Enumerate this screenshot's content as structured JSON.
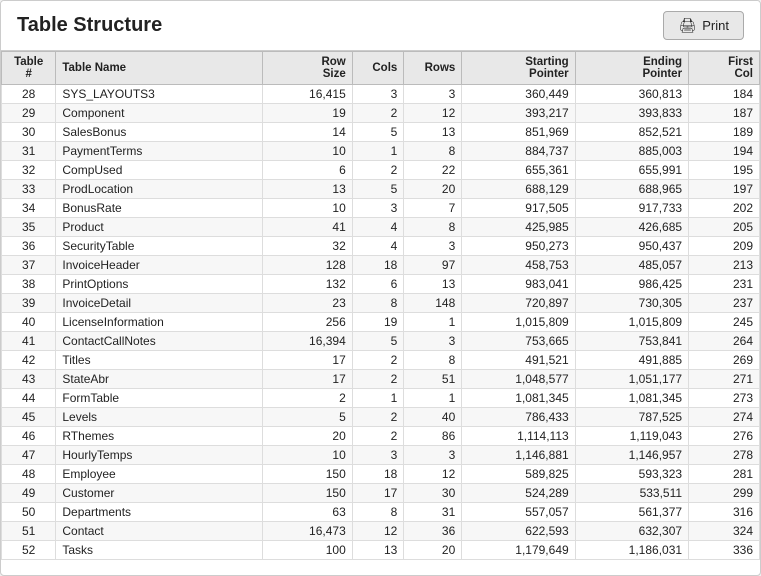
{
  "header": {
    "title": "Table Structure",
    "print_button": "Print"
  },
  "table": {
    "columns": [
      {
        "key": "table_num",
        "label": "Table\n#"
      },
      {
        "key": "table_name",
        "label": "Table Name"
      },
      {
        "key": "row_size",
        "label": "Row\nSize"
      },
      {
        "key": "cols",
        "label": "Cols"
      },
      {
        "key": "rows",
        "label": "Rows"
      },
      {
        "key": "starting_pointer",
        "label": "Starting\nPointer"
      },
      {
        "key": "ending_pointer",
        "label": "Ending\nPointer"
      },
      {
        "key": "first_col",
        "label": "First\nCol"
      }
    ],
    "rows": [
      {
        "table_num": "28",
        "table_name": "SYS_LAYOUTS3",
        "row_size": "16,415",
        "cols": "3",
        "rows": "3",
        "starting_pointer": "360,449",
        "ending_pointer": "360,813",
        "first_col": "184",
        "highlight": ""
      },
      {
        "table_num": "29",
        "table_name": "Component",
        "row_size": "19",
        "cols": "2",
        "rows": "12",
        "starting_pointer": "393,217",
        "ending_pointer": "393,833",
        "first_col": "187",
        "highlight": ""
      },
      {
        "table_num": "30",
        "table_name": "SalesBonus",
        "row_size": "14",
        "cols": "5",
        "rows": "13",
        "starting_pointer": "851,969",
        "ending_pointer": "852,521",
        "first_col": "189",
        "highlight": ""
      },
      {
        "table_num": "31",
        "table_name": "PaymentTerms",
        "row_size": "10",
        "cols": "1",
        "rows": "8",
        "starting_pointer": "884,737",
        "ending_pointer": "885,003",
        "first_col": "194",
        "highlight": "red"
      },
      {
        "table_num": "32",
        "table_name": "CompUsed",
        "row_size": "6",
        "cols": "2",
        "rows": "22",
        "starting_pointer": "655,361",
        "ending_pointer": "655,991",
        "first_col": "195",
        "highlight": ""
      },
      {
        "table_num": "33",
        "table_name": "ProdLocation",
        "row_size": "13",
        "cols": "5",
        "rows": "20",
        "starting_pointer": "688,129",
        "ending_pointer": "688,965",
        "first_col": "197",
        "highlight": "blue"
      },
      {
        "table_num": "34",
        "table_name": "BonusRate",
        "row_size": "10",
        "cols": "3",
        "rows": "7",
        "starting_pointer": "917,505",
        "ending_pointer": "917,733",
        "first_col": "202",
        "highlight": ""
      },
      {
        "table_num": "35",
        "table_name": "Product",
        "row_size": "41",
        "cols": "4",
        "rows": "8",
        "starting_pointer": "425,985",
        "ending_pointer": "426,685",
        "first_col": "205",
        "highlight": ""
      },
      {
        "table_num": "36",
        "table_name": "SecurityTable",
        "row_size": "32",
        "cols": "4",
        "rows": "3",
        "starting_pointer": "950,273",
        "ending_pointer": "950,437",
        "first_col": "209",
        "highlight": ""
      },
      {
        "table_num": "37",
        "table_name": "InvoiceHeader",
        "row_size": "128",
        "cols": "18",
        "rows": "97",
        "starting_pointer": "458,753",
        "ending_pointer": "485,057",
        "first_col": "213",
        "highlight": ""
      },
      {
        "table_num": "38",
        "table_name": "PrintOptions",
        "row_size": "132",
        "cols": "6",
        "rows": "13",
        "starting_pointer": "983,041",
        "ending_pointer": "986,425",
        "first_col": "231",
        "highlight": ""
      },
      {
        "table_num": "39",
        "table_name": "InvoiceDetail",
        "row_size": "23",
        "cols": "8",
        "rows": "148",
        "starting_pointer": "720,897",
        "ending_pointer": "730,305",
        "first_col": "237",
        "highlight": "blue"
      },
      {
        "table_num": "40",
        "table_name": "LicenseInformation",
        "row_size": "256",
        "cols": "19",
        "rows": "1",
        "starting_pointer": "1,015,809",
        "ending_pointer": "1,015,809",
        "first_col": "245",
        "highlight": "red"
      },
      {
        "table_num": "41",
        "table_name": "ContactCallNotes",
        "row_size": "16,394",
        "cols": "5",
        "rows": "3",
        "starting_pointer": "753,665",
        "ending_pointer": "753,841",
        "first_col": "264",
        "highlight": ""
      },
      {
        "table_num": "42",
        "table_name": "Titles",
        "row_size": "17",
        "cols": "2",
        "rows": "8",
        "starting_pointer": "491,521",
        "ending_pointer": "491,885",
        "first_col": "269",
        "highlight": ""
      },
      {
        "table_num": "43",
        "table_name": "StateAbr",
        "row_size": "17",
        "cols": "2",
        "rows": "51",
        "starting_pointer": "1,048,577",
        "ending_pointer": "1,051,177",
        "first_col": "271",
        "highlight": ""
      },
      {
        "table_num": "44",
        "table_name": "FormTable",
        "row_size": "2",
        "cols": "1",
        "rows": "1",
        "starting_pointer": "1,081,345",
        "ending_pointer": "1,081,345",
        "first_col": "273",
        "highlight": "red"
      },
      {
        "table_num": "45",
        "table_name": "Levels",
        "row_size": "5",
        "cols": "2",
        "rows": "40",
        "starting_pointer": "786,433",
        "ending_pointer": "787,525",
        "first_col": "274",
        "highlight": "blue"
      },
      {
        "table_num": "46",
        "table_name": "RThemes",
        "row_size": "20",
        "cols": "2",
        "rows": "86",
        "starting_pointer": "1,114,113",
        "ending_pointer": "1,119,043",
        "first_col": "276",
        "highlight": ""
      },
      {
        "table_num": "47",
        "table_name": "HourlyTemps",
        "row_size": "10",
        "cols": "3",
        "rows": "3",
        "starting_pointer": "1,146,881",
        "ending_pointer": "1,146,957",
        "first_col": "278",
        "highlight": ""
      },
      {
        "table_num": "48",
        "table_name": "Employee",
        "row_size": "150",
        "cols": "18",
        "rows": "12",
        "starting_pointer": "589,825",
        "ending_pointer": "593,323",
        "first_col": "281",
        "highlight": ""
      },
      {
        "table_num": "49",
        "table_name": "Customer",
        "row_size": "150",
        "cols": "17",
        "rows": "30",
        "starting_pointer": "524,289",
        "ending_pointer": "533,511",
        "first_col": "299",
        "highlight": ""
      },
      {
        "table_num": "50",
        "table_name": "Departments",
        "row_size": "63",
        "cols": "8",
        "rows": "31",
        "starting_pointer": "557,057",
        "ending_pointer": "561,377",
        "first_col": "316",
        "highlight": ""
      },
      {
        "table_num": "51",
        "table_name": "Contact",
        "row_size": "16,473",
        "cols": "12",
        "rows": "36",
        "starting_pointer": "622,593",
        "ending_pointer": "632,307",
        "first_col": "324",
        "highlight": ""
      },
      {
        "table_num": "52",
        "table_name": "Tasks",
        "row_size": "100",
        "cols": "13",
        "rows": "20",
        "starting_pointer": "1,179,649",
        "ending_pointer": "1,186,031",
        "first_col": "336",
        "highlight": ""
      }
    ]
  }
}
